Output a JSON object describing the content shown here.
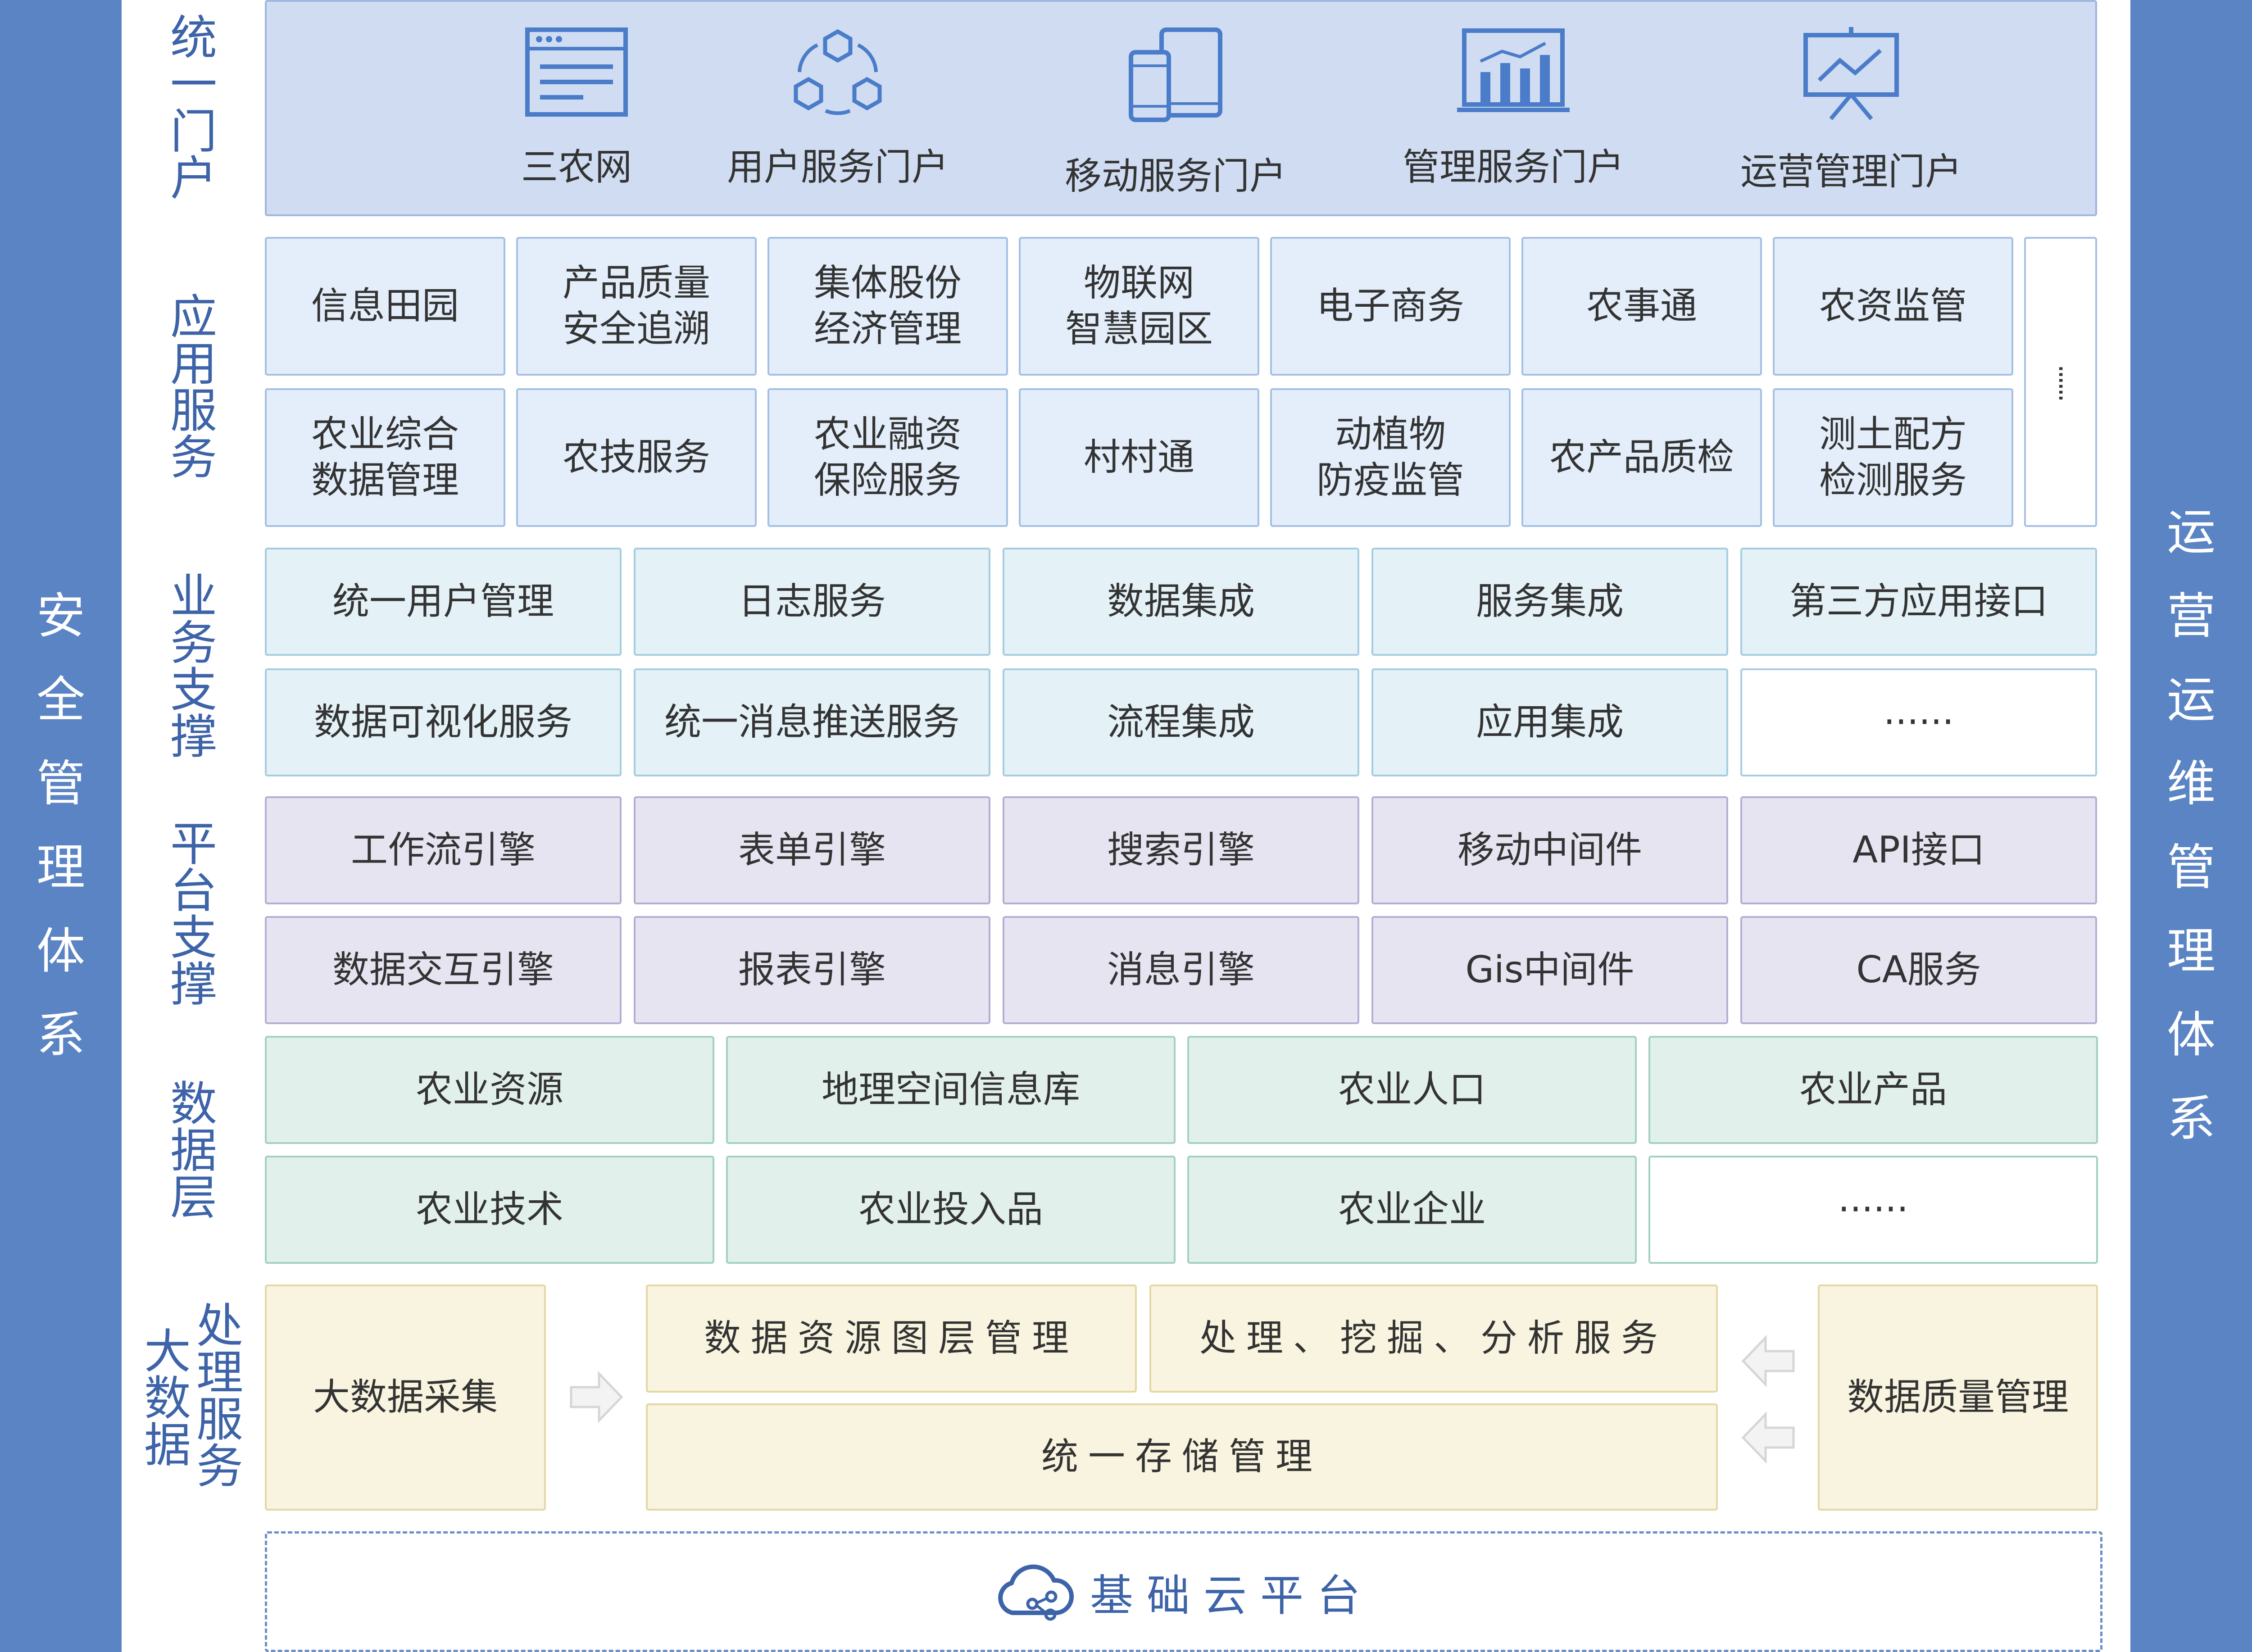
{
  "side_left": {
    "chars": [
      "安",
      "全",
      "管",
      "理",
      "体",
      "系"
    ]
  },
  "side_right": {
    "chars": [
      "运",
      "营",
      "运",
      "维",
      "管",
      "理",
      "体",
      "系"
    ]
  },
  "layers": {
    "portal": {
      "chars": [
        "统",
        "一",
        "门",
        "户"
      ]
    },
    "app": {
      "chars": [
        "应",
        "用",
        "服",
        "务"
      ]
    },
    "biz": {
      "chars": [
        "业",
        "务",
        "支",
        "撑"
      ]
    },
    "plat": {
      "chars": [
        "平",
        "台",
        "支",
        "撑"
      ]
    },
    "data": {
      "chars": [
        "数",
        "据",
        "层"
      ]
    },
    "bigdata": {
      "left": [
        "大",
        "数",
        "据"
      ],
      "right": [
        "处",
        "理",
        "服",
        "务"
      ]
    }
  },
  "portal_items": [
    {
      "label": "三农网",
      "icon": "web-window-icon"
    },
    {
      "label": "用户服务门户",
      "icon": "user-network-icon"
    },
    {
      "label": "移动服务门户",
      "icon": "mobile-tablet-icon"
    },
    {
      "label": "管理服务门户",
      "icon": "bar-chart-icon"
    },
    {
      "label": "运营管理门户",
      "icon": "presentation-board-icon"
    }
  ],
  "app_services": [
    [
      "信息田园",
      "产品质量\n安全追溯",
      "集体股份\n经济管理",
      "物联网\n智慧园区",
      "电子商务",
      "农事通",
      "农资监管"
    ],
    [
      "农业综合\n数据管理",
      "农技服务",
      "农业融资\n保险服务",
      "村村通",
      "动植物\n防疫监管",
      "农产品质检",
      "测土配方\n检测服务"
    ]
  ],
  "app_more": "······",
  "biz_support": [
    [
      "统一用户管理",
      "日志服务",
      "数据集成",
      "服务集成",
      "第三方应用接口"
    ],
    [
      "数据可视化服务",
      "统一消息推送服务",
      "流程集成",
      "应用集成",
      "······"
    ]
  ],
  "platform_support": [
    [
      "工作流引擎",
      "表单引擎",
      "搜索引擎",
      "移动中间件",
      "API接口"
    ],
    [
      "数据交互引擎",
      "报表引擎",
      "消息引擎",
      "Gis中间件",
      "CA服务"
    ]
  ],
  "data_layer": [
    [
      "农业资源",
      "地理空间信息库",
      "农业人口",
      "农业产品"
    ],
    [
      "农业技术",
      "农业投入品",
      "农业企业",
      "······"
    ]
  ],
  "bigdata": {
    "collect": "大数据采集",
    "resource": "数据资源图层管理",
    "process": "处理、挖掘、分析服务",
    "storage": "统一存储管理",
    "quality": "数据质量管理"
  },
  "cloud": {
    "label": "基础云平台"
  },
  "colors": {
    "side": "#5b84c4",
    "label": "#3d63a8",
    "portal": "#cfdcf2"
  }
}
